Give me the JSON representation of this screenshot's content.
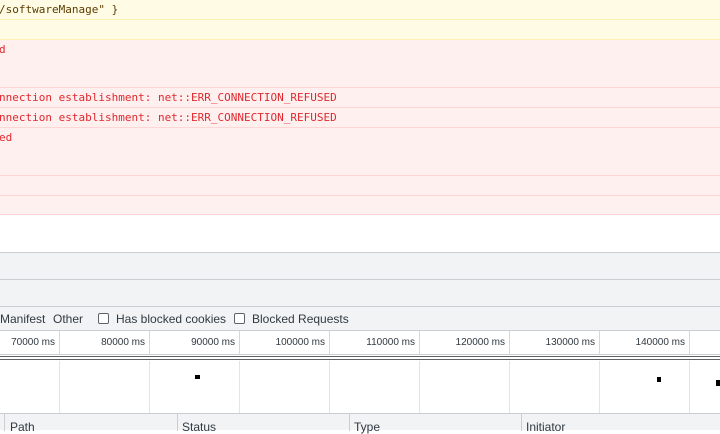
{
  "console": {
    "warning_text": "/softwareManage\" }",
    "error_lines": [
      "d",
      "nnection establishment: net::ERR_CONNECTION_REFUSED",
      "nnection establishment: net::ERR_CONNECTION_REFUSED",
      "ed"
    ]
  },
  "network": {
    "filters": {
      "manifest": "Manifest",
      "other": "Other",
      "has_blocked_cookies": "Has blocked cookies",
      "blocked_requests": "Blocked Requests"
    },
    "timeline_ticks": [
      "70000 ms",
      "80000 ms",
      "90000 ms",
      "100000 ms",
      "110000 ms",
      "120000 ms",
      "130000 ms",
      "140000 ms"
    ],
    "columns": {
      "path": "Path",
      "status": "Status",
      "type": "Type",
      "initiator": "Initiator"
    }
  }
}
